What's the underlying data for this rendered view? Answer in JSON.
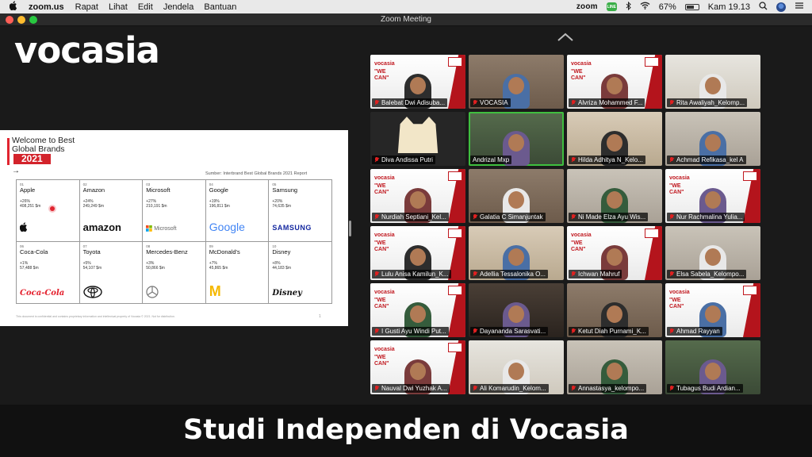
{
  "menubar": {
    "app_name": "zoom.us",
    "menus": [
      "Rapat",
      "Lihat",
      "Edit",
      "Jendela",
      "Bantuan"
    ],
    "status": {
      "zoom": "zoom",
      "line": "LINE",
      "battery": "67%",
      "datetime": "Kam 19.13"
    }
  },
  "window": {
    "title": "Zoom Meeting"
  },
  "brand_logo": "vocasia",
  "shared_screen": {
    "heading": "Welcome to Best Global Brands",
    "year": "2021",
    "arrow": "→",
    "source": "Sumber: Interbrand Best Global Brands 2021 Report",
    "brands": [
      {
        "rank": "01",
        "name": "Apple",
        "change": "+26%",
        "value": "408,251 $m",
        "logo": ""
      },
      {
        "rank": "02",
        "name": "Amazon",
        "change": "+24%",
        "value": "249,249 $m",
        "logo": "amazon"
      },
      {
        "rank": "03",
        "name": "Microsoft",
        "change": "+27%",
        "value": "210,191 $m",
        "logo": "Microsoft"
      },
      {
        "rank": "04",
        "name": "Google",
        "change": "+19%",
        "value": "196,811 $m",
        "logo": "Google"
      },
      {
        "rank": "05",
        "name": "Samsung",
        "change": "+20%",
        "value": "74,635 $m",
        "logo": "SAMSUNG"
      },
      {
        "rank": "06",
        "name": "Coca-Cola",
        "change": "+1%",
        "value": "57,488 $m",
        "logo": "Coca-Cola"
      },
      {
        "rank": "07",
        "name": "Toyota",
        "change": "+5%",
        "value": "54,107 $m",
        "logo": ""
      },
      {
        "rank": "08",
        "name": "Mercedes-Benz",
        "change": "+3%",
        "value": "50,866 $m",
        "logo": ""
      },
      {
        "rank": "09",
        "name": "McDonald's",
        "change": "+7%",
        "value": "45,865 $m",
        "logo": "M"
      },
      {
        "rank": "10",
        "name": "Disney",
        "change": "+8%",
        "value": "44,183 $m",
        "logo": "Disney"
      }
    ],
    "footer": "This document is confidential and contains proprietary information and intellectual property of Vocasia © 2021. Not for distribution.",
    "page_number": "1"
  },
  "participants": [
    {
      "name": "Balebat Dwi Adisuba...",
      "muted": true,
      "bg": "vbg"
    },
    {
      "name": "VOCASIA",
      "muted": true,
      "bg": "room"
    },
    {
      "name": "Alvriza Mohammed F...",
      "muted": true,
      "bg": "vbg"
    },
    {
      "name": "Rita Awaliyah_Kelomp...",
      "muted": true,
      "bg": "room4"
    },
    {
      "name": "Diva Andissa Putri",
      "muted": true,
      "bg": "cat"
    },
    {
      "name": "Andrizal Mxp",
      "muted": false,
      "bg": "room3",
      "active": true
    },
    {
      "name": "Hilda Adhitya N_Kelo...",
      "muted": true,
      "bg": "room6"
    },
    {
      "name": "Achmad Refikasa_kel A",
      "muted": true,
      "bg": "room2"
    },
    {
      "name": "Nurdiah Septiani_Kel...",
      "muted": true,
      "bg": "vbg"
    },
    {
      "name": "Galatia C Simanjuntak",
      "muted": true,
      "bg": "room"
    },
    {
      "name": "Ni Made Elza Ayu Wis...",
      "muted": true,
      "bg": "room2"
    },
    {
      "name": "Nur Rachmalina Yulia...",
      "muted": true,
      "bg": "vbg"
    },
    {
      "name": "Lulu Anisa Kamilun_K...",
      "muted": true,
      "bg": "vbg"
    },
    {
      "name": "Adellia Tessalonika O...",
      "muted": true,
      "bg": "room6"
    },
    {
      "name": "Ichwan Mahruf",
      "muted": true,
      "bg": "vbg"
    },
    {
      "name": "Elsa Sabela_Kelompo...",
      "muted": true,
      "bg": "room2"
    },
    {
      "name": "I Gusti Ayu Windi Put...",
      "muted": true,
      "bg": "vbg"
    },
    {
      "name": "Dayananda Sarasvati...",
      "muted": true,
      "bg": "room5"
    },
    {
      "name": "Ketut Diah Purnami_K...",
      "muted": true,
      "bg": "room"
    },
    {
      "name": "Ahmad Rayyan",
      "muted": true,
      "bg": "vbg"
    },
    {
      "name": "Nauval Dwi Yuzhak A...",
      "muted": true,
      "bg": "vbg"
    },
    {
      "name": "Ali Komarudin_Kelom...",
      "muted": true,
      "bg": "room4"
    },
    {
      "name": "Annastasya_kelompo...",
      "muted": true,
      "bg": "room2"
    },
    {
      "name": "Tubagus Budi Ardian...",
      "muted": true,
      "bg": "room3"
    }
  ],
  "virtual_bg": {
    "brand": "vocasia",
    "tag": "\"WE CAN\""
  },
  "caption": "Studi Independen di Vocasia",
  "colors": {
    "accent_red": "#d3232b",
    "active_speaker": "#3fbf3f",
    "menubar": "#e9e9e9"
  }
}
